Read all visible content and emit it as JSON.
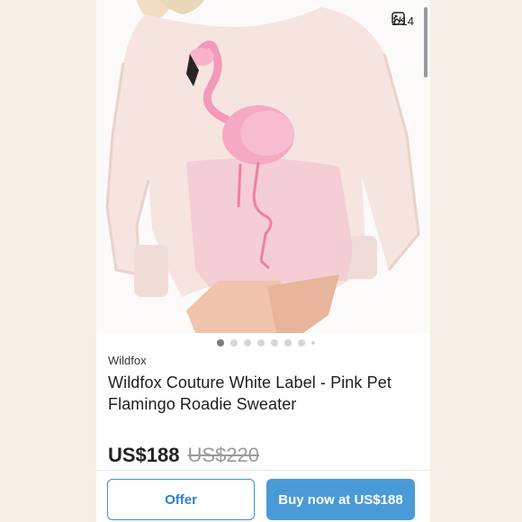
{
  "gallery": {
    "counter": "1/14",
    "icon": "image-gallery-icon",
    "dots": [
      true,
      false,
      false,
      false,
      false,
      false,
      false,
      false
    ]
  },
  "listing": {
    "brand": "Wildfox",
    "title": "Wildfox Couture White Label - Pink Pet Flamingo Roadie Sweater",
    "price": "US$188",
    "original_price": "US$220"
  },
  "actions": {
    "offer_label": "Offer",
    "buy_label": "Buy now at US$188"
  },
  "colors": {
    "accent": "#4a9ad8",
    "sweater": "#f6e4e1",
    "flamingo": "#f29ab8"
  }
}
